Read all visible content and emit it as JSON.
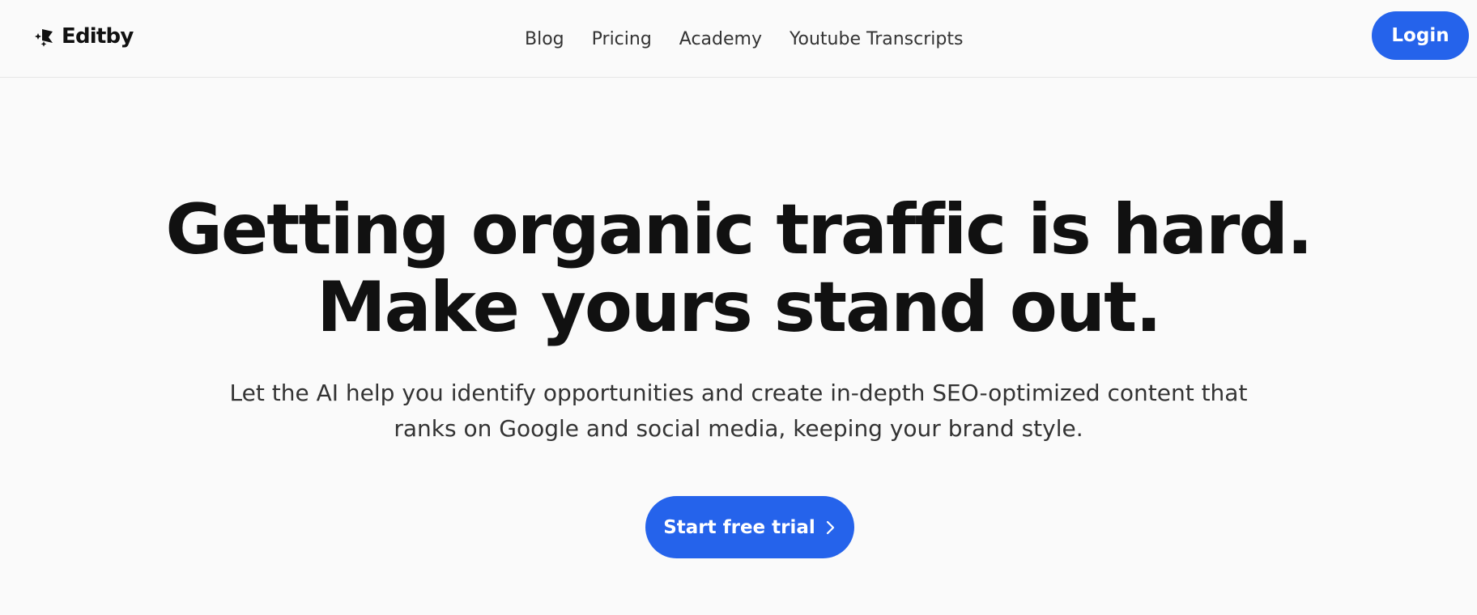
{
  "header": {
    "logo_text": "Editby",
    "logo_icon": "editby-logo-icon",
    "nav": [
      {
        "label": "Blog"
      },
      {
        "label": "Pricing"
      },
      {
        "label": "Academy"
      },
      {
        "label": "Youtube Transcripts"
      }
    ],
    "login_label": "Login"
  },
  "hero": {
    "title_line1": "Getting organic traffic is hard.",
    "title_line2": "Make yours stand out.",
    "subtitle_line1": "Let the AI help you identify opportunities and create in-depth SEO-optimized content that",
    "subtitle_line2": "ranks on Google and social media, keeping your brand style.",
    "cta_label": "Start free trial",
    "cta_icon": "chevron-right-icon"
  },
  "colors": {
    "accent": "#2563eb",
    "background": "#fafafa",
    "text": "#111111"
  }
}
